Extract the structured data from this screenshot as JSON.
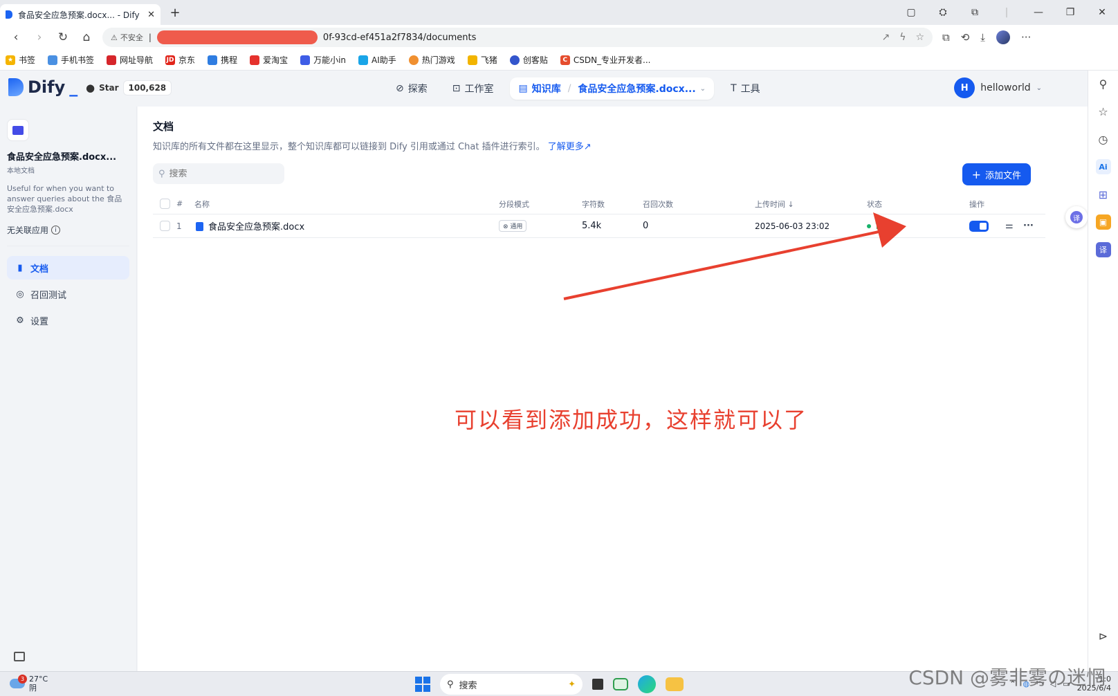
{
  "browser": {
    "tab_title": "食品安全应急预案.docx... - Dify",
    "insecure_label": "不安全",
    "url_visible": "0f-93cd-ef451a2f7834/documents"
  },
  "bookmarks": [
    {
      "label": "书签",
      "color": "#f5b400"
    },
    {
      "label": "手机书签",
      "color": "#4a90e2"
    },
    {
      "label": "网址导航",
      "color": "#d6262b"
    },
    {
      "label": "京东",
      "color": "#e1251b"
    },
    {
      "label": "携程",
      "color": "#2f7de1"
    },
    {
      "label": "爱淘宝",
      "color": "#e5322d"
    },
    {
      "label": "万能小in",
      "color": "#3e5de6"
    },
    {
      "label": "AI助手",
      "color": "#1aa5e8"
    },
    {
      "label": "热门游戏",
      "color": "#f09030"
    },
    {
      "label": "飞猪",
      "color": "#f2b400"
    },
    {
      "label": "创客贴",
      "color": "#3355cc"
    },
    {
      "label": "CSDN_专业开发者...",
      "color": "#e54d2e"
    }
  ],
  "app": {
    "logo": "Dify",
    "github_star_label": "Star",
    "github_star_count": "100,628",
    "nav": {
      "explore": "探索",
      "studio": "工作室",
      "knowledge": "知识库",
      "current_kb": "食品安全应急预案.docx...",
      "tools": "工具"
    },
    "user": {
      "initial": "H",
      "name": "helloworld"
    }
  },
  "sidebar": {
    "kb_name": "食品安全应急预案.docx...",
    "kb_type": "本地文档",
    "kb_desc": "Useful for when you want to answer queries about the 食品安全应急预案.docx",
    "linked_apps": "无关联应用",
    "items": [
      {
        "label": "文档"
      },
      {
        "label": "召回测试"
      },
      {
        "label": "设置"
      }
    ]
  },
  "documents": {
    "title": "文档",
    "description": "知识库的所有文件都在这里显示，整个知识库都可以链接到 Dify 引用或通过 Chat 插件进行索引。",
    "learn_more": "了解更多",
    "search_placeholder": "搜索",
    "add_button": "添加文件",
    "columns": {
      "index": "#",
      "name": "名称",
      "mode": "分段模式",
      "chars": "字符数",
      "hits": "召回次数",
      "upload_time": "上传时间",
      "status": "状态",
      "actions": "操作"
    },
    "rows": [
      {
        "index": "1",
        "name": "食品安全应急预案.docx",
        "mode": "通用",
        "chars": "5.4k",
        "hits": "0",
        "upload_time": "2025-06-03 23:02",
        "status": "可用",
        "enabled": true
      }
    ]
  },
  "annotation": "可以看到添加成功，这样就可以了",
  "taskbar": {
    "weather_temp": "27°C",
    "weather_desc": "阴",
    "weather_badge": "3",
    "search_label": "搜索",
    "clock_time": "1:0",
    "clock_date": "2025/6/4"
  },
  "watermark": "CSDN @雾非雾の迷惘",
  "colors": {
    "primary": "#155aef",
    "status_ok": "#17b26a",
    "annotation": "#e8402f"
  }
}
